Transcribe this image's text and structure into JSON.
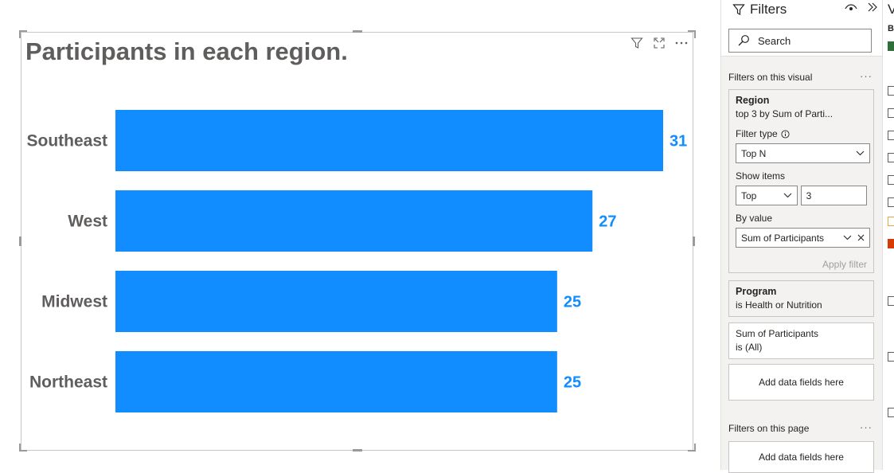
{
  "visual": {
    "title": "Participants in each region."
  },
  "chart_data": {
    "type": "bar",
    "orientation": "horizontal",
    "title": "Participants in each region.",
    "categories": [
      "Southeast",
      "West",
      "Midwest",
      "Northeast"
    ],
    "values": [
      31,
      27,
      25,
      25
    ],
    "xlim": [
      0,
      31
    ],
    "grid": false,
    "data_labels": true,
    "bar_color": "#118DFF",
    "label_color": "#118DFF",
    "category_label_color": "#605E5C"
  },
  "filters_pane": {
    "title": "Filters",
    "search_placeholder": "Search",
    "on_visual_label": "Filters on this visual",
    "on_page_label": "Filters on this page",
    "region_card": {
      "title": "Region",
      "summary": "top 3 by Sum of Parti...",
      "filter_type_label": "Filter type",
      "filter_type_value": "Top N",
      "show_items_label": "Show items",
      "show_items_direction": "Top",
      "show_items_count": "3",
      "by_value_label": "By value",
      "by_value_field": "Sum of Participants",
      "apply_label": "Apply filter"
    },
    "program_card": {
      "title": "Program",
      "summary": "is Health or Nutrition"
    },
    "participants_card": {
      "title": "Sum of Participants",
      "summary": "is (All)"
    },
    "add_fields_label": "Add data fields here"
  },
  "viz_pane": {
    "title_partial": "V",
    "build_partial": "B"
  }
}
